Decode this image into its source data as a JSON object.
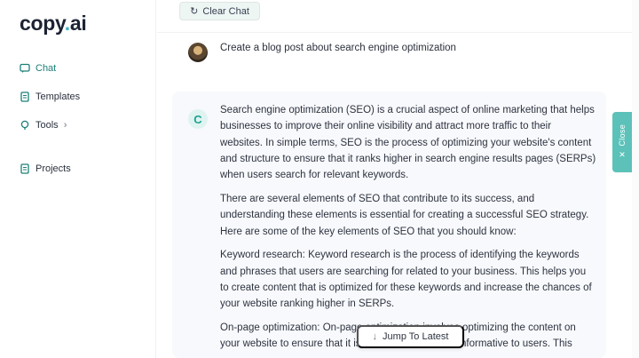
{
  "app": {
    "logo_prefix": "copy",
    "logo_dot": ".",
    "logo_suffix": "ai"
  },
  "sidebar": {
    "items": [
      {
        "label": "Chat",
        "icon": "chat-bubble-icon",
        "active": true
      },
      {
        "label": "Templates",
        "icon": "document-icon"
      },
      {
        "label": "Tools",
        "icon": "bulb-icon",
        "chevron": "›"
      },
      {
        "label": "Projects",
        "icon": "folder-icon"
      }
    ]
  },
  "toolbar": {
    "clear_label": "Clear Chat",
    "clear_icon": "↻"
  },
  "conversation": {
    "user_message": "Create a blog post about search engine optimization",
    "ai_avatar_letter": "C",
    "ai_paragraphs": [
      "Search engine optimization (SEO) is a crucial aspect of online marketing that helps businesses to improve their online visibility and attract more traffic to their websites. In simple terms, SEO is the process of optimizing your website's content and structure to ensure that it ranks higher in search engine results pages (SERPs) when users search for relevant keywords.",
      "There are several elements of SEO that contribute to its success, and understanding these elements is essential for creating a successful SEO strategy. Here are some of the key elements of SEO that you should know:",
      "Keyword research: Keyword research is the process of identifying the keywords and phrases that users are searching for related to your business. This helps you to create content that is optimized for these keywords and increase the chances of your website ranking higher in SERPs.",
      "On-page optimization: On-page optimization involves optimizing the content on your website to ensure that it is relevant, useful, and informative to users. This"
    ]
  },
  "close_tab": {
    "label": "Close",
    "icon": "✕"
  },
  "jump": {
    "label": "Jump To Latest",
    "icon": "↓"
  },
  "colors": {
    "accent": "#5cc2b9",
    "brand_dot": "#3fb5c4",
    "active_nav": "#1b7f78"
  }
}
